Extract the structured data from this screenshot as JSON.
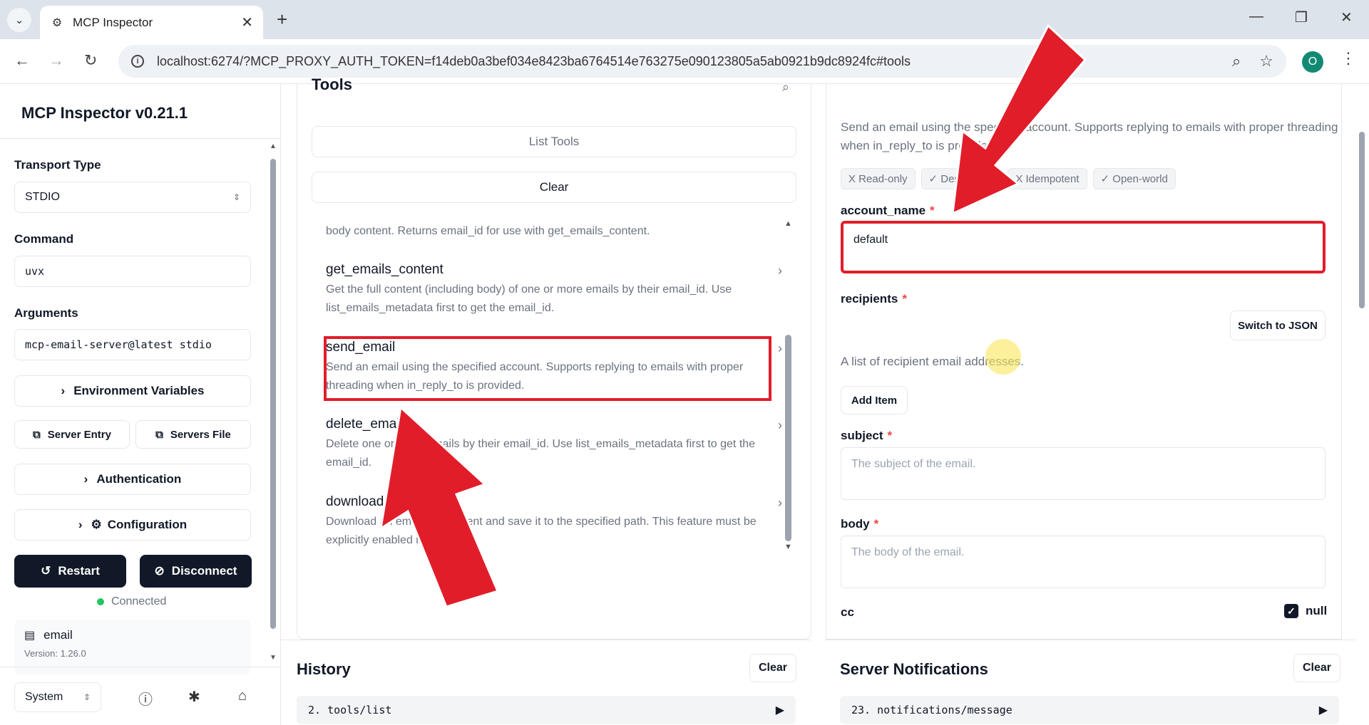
{
  "browser": {
    "tab_title": "MCP Inspector",
    "url": "localhost:6274/?MCP_PROXY_AUTH_TOKEN=f14deb0a3bef034e8423ba6764514e763275e090123805a5ab0921b9dc8924fc#tools",
    "profile_initial": "O"
  },
  "sidebar": {
    "title": "MCP Inspector v0.21.1",
    "transport_label": "Transport Type",
    "transport_value": "STDIO",
    "command_label": "Command",
    "command_value": "uvx",
    "arguments_label": "Arguments",
    "arguments_value": "mcp-email-server@latest stdio",
    "env_vars_label": "Environment Variables",
    "server_entry_label": "Server Entry",
    "servers_file_label": "Servers File",
    "authentication_label": "Authentication",
    "configuration_label": "Configuration",
    "restart_label": "Restart",
    "disconnect_label": "Disconnect",
    "status_text": "Connected",
    "server_name": "email",
    "server_version": "Version: 1.26.0",
    "theme_value": "System"
  },
  "tools": {
    "heading": "Tools",
    "list_tools_label": "List Tools",
    "clear_label": "Clear",
    "truncated_desc": "body content. Returns email_id for use with get_emails_content.",
    "items": [
      {
        "name": "get_emails_content",
        "desc": "Get the full content (including body) of one or more emails by their email_id. Use list_emails_metadata first to get the email_id."
      },
      {
        "name": "send_email",
        "desc": "Send an email using the specified account. Supports replying to emails with proper threading when in_reply_to is provided."
      },
      {
        "name": "delete_emails",
        "desc": "Delete one or more emails by their email_id. Use list_emails_metadata first to get the email_id."
      },
      {
        "name": "download_attachment",
        "desc": "Download an email attachment and save it to the specified path. This feature must be explicitly enabled in settings..."
      }
    ]
  },
  "history": {
    "title": "History",
    "clear_label": "Clear",
    "row": "2. tools/list"
  },
  "form": {
    "description": "Send an email using the specified account. Supports replying to emails with proper threading when in_reply_to is provided.",
    "badges": [
      "X Read-only",
      "✓ Destructive",
      "X Idempotent",
      "✓ Open-world"
    ],
    "account_label": "account_name",
    "account_value": "default",
    "recipients_label": "recipients",
    "switch_json_label": "Switch to JSON",
    "recipients_help": "A list of recipient email addresses.",
    "add_item_label": "Add Item",
    "subject_label": "subject",
    "subject_placeholder": "The subject of the email.",
    "body_label": "body",
    "body_placeholder": "The body of the email.",
    "cc_label": "cc",
    "null_label": "null",
    "required_mark": "*"
  },
  "notifications": {
    "title": "Server Notifications",
    "clear_label": "Clear",
    "row": "23. notifications/message"
  },
  "colors": {
    "annotation_red": "#e11d2a",
    "dark_button": "#111827",
    "connected_green": "#22c55e"
  }
}
